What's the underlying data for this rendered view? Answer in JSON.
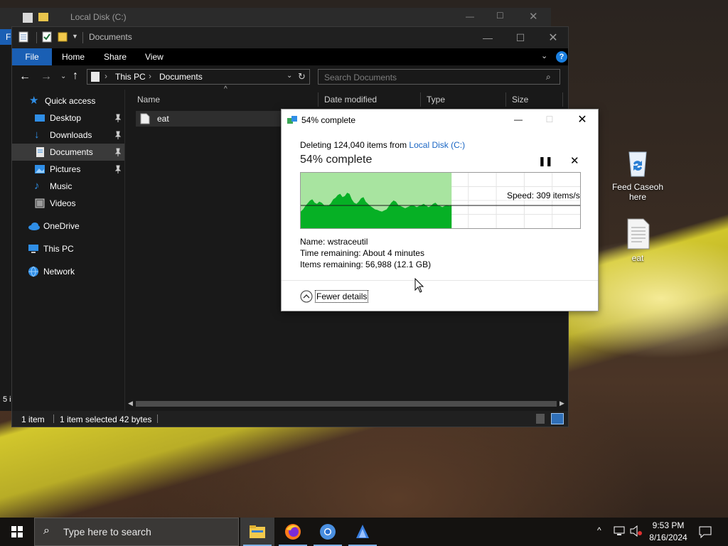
{
  "desktop": {
    "icons": [
      {
        "label": "Feed Caseoh here",
        "icon": "recycle-bin-icon"
      },
      {
        "label": "eat",
        "icon": "text-file-icon"
      }
    ]
  },
  "back_window": {
    "title": "Local Disk (C:)"
  },
  "left_edge": {
    "file_tab": "F",
    "count": "5 i"
  },
  "explorer": {
    "title": "Documents",
    "ribbon_tabs": [
      "File",
      "Home",
      "Share",
      "View"
    ],
    "address": {
      "segments": [
        "This PC",
        "Documents"
      ]
    },
    "search": {
      "placeholder": "Search Documents"
    },
    "nav": [
      {
        "label": "Quick access",
        "icon": "star-icon"
      },
      {
        "label": "Desktop",
        "icon": "desktop-icon",
        "pinned": true
      },
      {
        "label": "Downloads",
        "icon": "download-icon",
        "pinned": true
      },
      {
        "label": "Documents",
        "icon": "documents-icon",
        "pinned": true,
        "selected": true
      },
      {
        "label": "Pictures",
        "icon": "pictures-icon",
        "pinned": true
      },
      {
        "label": "Music",
        "icon": "music-icon"
      },
      {
        "label": "Videos",
        "icon": "videos-icon"
      },
      {
        "label": "OneDrive",
        "icon": "cloud-icon"
      },
      {
        "label": "This PC",
        "icon": "computer-icon"
      },
      {
        "label": "Network",
        "icon": "network-icon"
      }
    ],
    "columns": [
      "Name",
      "Date modified",
      "Type",
      "Size"
    ],
    "files": [
      {
        "name": "eat",
        "icon": "text-file-icon"
      }
    ],
    "status": {
      "count": "1 item",
      "selection": "1 item selected  42 bytes"
    }
  },
  "dialog": {
    "title": "54% complete",
    "deleting_prefix": "Deleting 124,040 items from ",
    "location": "Local Disk (C:)",
    "progress_text": "54% complete",
    "progress": 0.54,
    "speed": "Speed: 309 items/s",
    "details": {
      "name_label": "Name:",
      "name_value": "wstraceutil",
      "time_label": "Time remaining:",
      "time_value": "About 4 minutes",
      "items_label": "Items remaining:",
      "items_value": "56,988 (12.1 GB)"
    },
    "fewer_details": "Fewer details",
    "colors": {
      "fill": "#a8e4a0",
      "graph": "#06b025"
    }
  },
  "chart_data": {
    "type": "area",
    "title": "",
    "xlabel": "",
    "ylabel": "",
    "progress_fraction": 0.54,
    "speed_marker": "Speed: 309 items/s",
    "series": [
      {
        "values": [
          0.3,
          0.34,
          0.4,
          0.45,
          0.5,
          0.52,
          0.46,
          0.44,
          0.48,
          0.46,
          0.42,
          0.4,
          0.41,
          0.45,
          0.52,
          0.55,
          0.6,
          0.62,
          0.56,
          0.58,
          0.64,
          0.62,
          0.52,
          0.46,
          0.44,
          0.48,
          0.54,
          0.56,
          0.48,
          0.44,
          0.4,
          0.37,
          0.34,
          0.33,
          0.31,
          0.3,
          0.32,
          0.34,
          0.4,
          0.46,
          0.5,
          0.48,
          0.42,
          0.4,
          0.38,
          0.36,
          0.38,
          0.4,
          0.42,
          0.4,
          0.38,
          0.4,
          0.42,
          0.44,
          0.41,
          0.38,
          0.4,
          0.44,
          0.46,
          0.42,
          0.4,
          0.38,
          0.4,
          0.42,
          0.4,
          0.41
        ]
      }
    ]
  },
  "taskbar": {
    "search_placeholder": "Type here to search",
    "time": "9:53 PM",
    "date": "8/16/2024"
  }
}
